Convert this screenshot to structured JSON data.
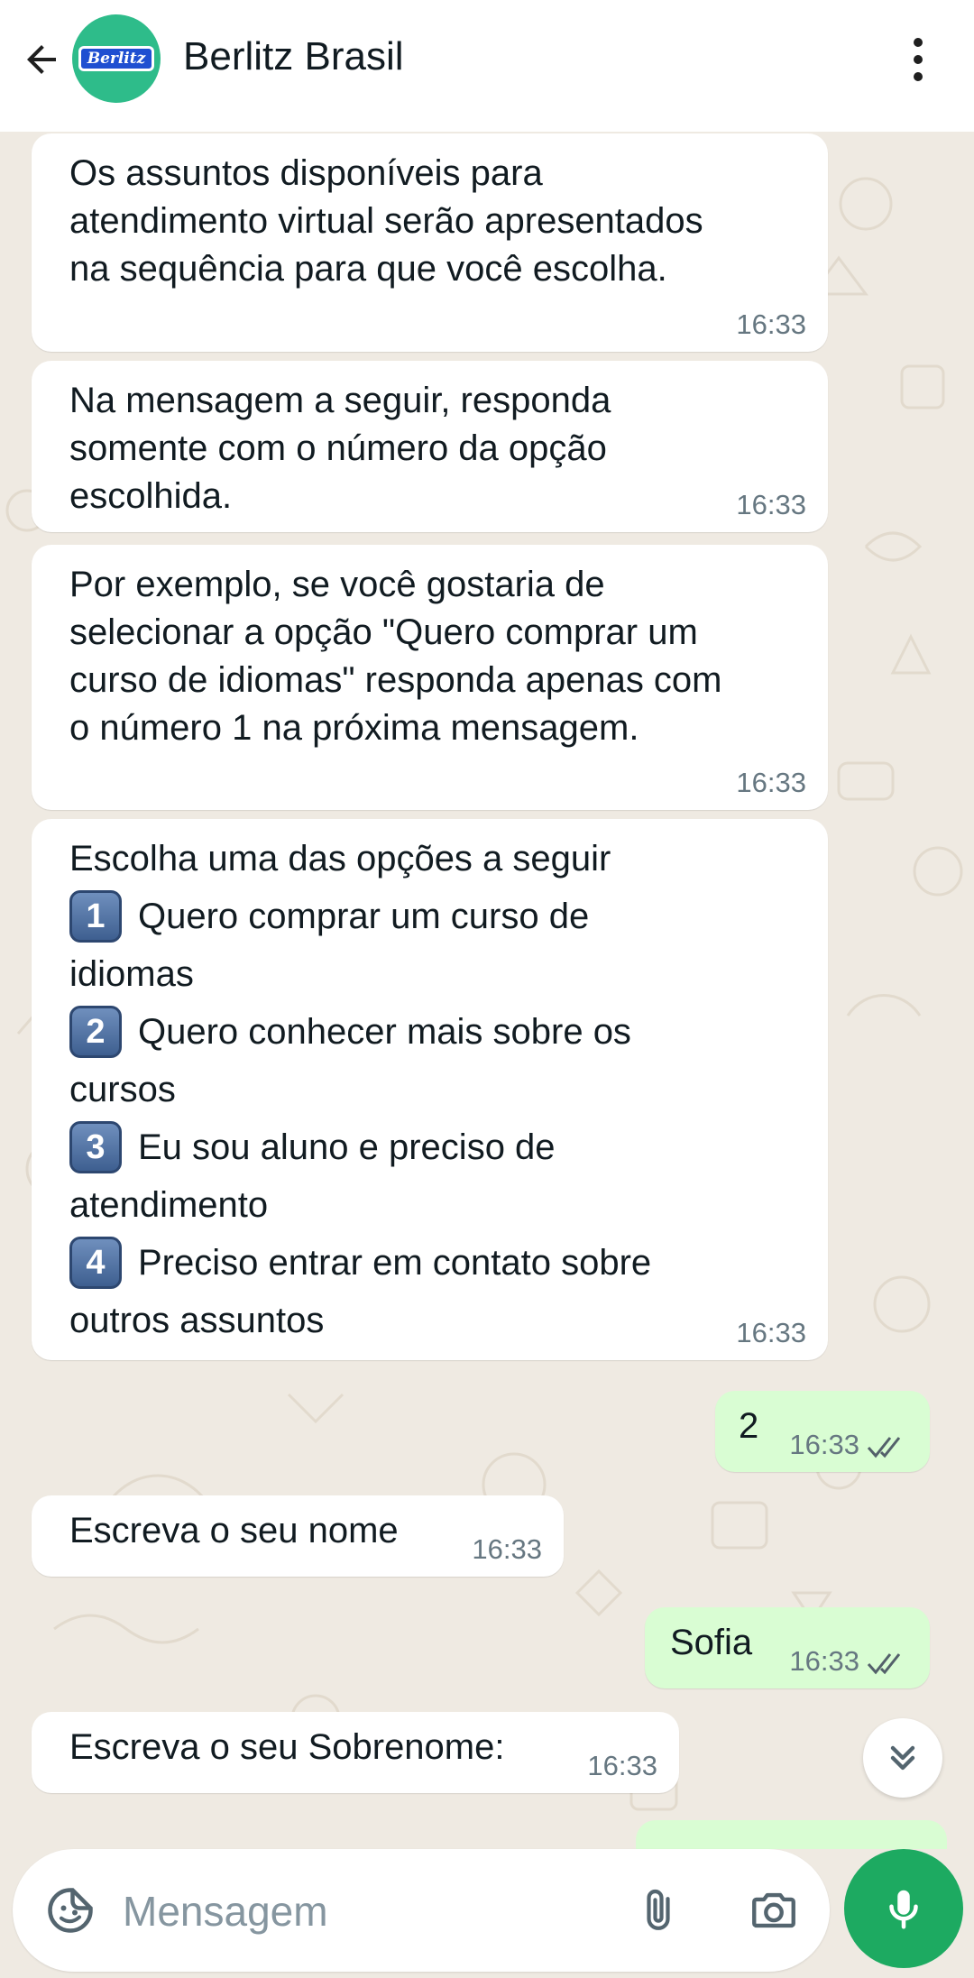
{
  "header": {
    "contact_name": "Berlitz Brasil",
    "avatar_text": "Berlitz",
    "icons": {
      "back": "arrow-left-icon",
      "menu": "more-vertical-icon"
    }
  },
  "messages": [
    {
      "direction": "incoming",
      "text": "Os assuntos disponíveis para\natendimento virtual serão apresentados\nna sequência para que você escolha.",
      "time": "16:33"
    },
    {
      "direction": "incoming",
      "text": "Na mensagem a seguir, responda\nsomente com o número da opção\nescolhida.",
      "time": "16:33"
    },
    {
      "direction": "incoming",
      "text": "Por exemplo, se você gostaria de\nselecionar a opção \"Quero comprar um\ncurso de idiomas\" responda apenas com\no número 1 na próxima mensagem.",
      "time": "16:33"
    },
    {
      "direction": "incoming",
      "intro": "Escolha uma das opções a seguir",
      "options": [
        {
          "key": "1",
          "line1": "Quero comprar um curso de",
          "line2": "idiomas"
        },
        {
          "key": "2",
          "line1": "Quero conhecer mais sobre os",
          "line2": "cursos"
        },
        {
          "key": "3",
          "line1": "Eu sou aluno e preciso de",
          "line2": "atendimento"
        },
        {
          "key": "4",
          "line1": "Preciso entrar em contato sobre",
          "line2": "outros assuntos"
        }
      ],
      "time": "16:33"
    },
    {
      "direction": "outgoing",
      "text": "2",
      "time": "16:33",
      "status": "read"
    },
    {
      "direction": "incoming",
      "text": "Escreva o seu nome",
      "time": "16:33"
    },
    {
      "direction": "outgoing",
      "text": "Sofia",
      "time": "16:33",
      "status": "read"
    },
    {
      "direction": "incoming",
      "text": "Escreva o seu Sobrenome:",
      "time": "16:33"
    }
  ],
  "composer": {
    "placeholder": "Mensagem",
    "value": "",
    "icons": {
      "sticker": "sticker-icon",
      "attach": "paperclip-icon",
      "camera": "camera-icon",
      "mic": "microphone-icon"
    }
  },
  "scroll_button_icon": "double-chevron-down-icon",
  "colors": {
    "header_bg": "#ffffff",
    "chat_bg": "#efeae2",
    "incoming_bubble": "#ffffff",
    "outgoing_bubble": "#d9fdd3",
    "mic_button": "#1daa61",
    "avatar_bg": "#2ebc8a",
    "timestamp": "#667781"
  }
}
